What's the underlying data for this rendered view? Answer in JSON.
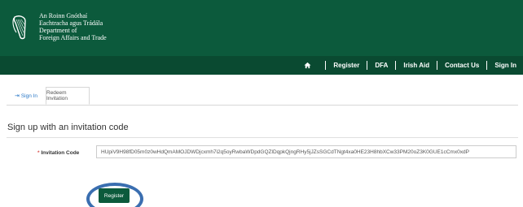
{
  "header": {
    "department_lines": [
      "An Roinn Gnóthaí",
      "Eachtracha agus Trádála",
      "Department of",
      "Foreign Affairs and Trade"
    ],
    "brand_color": "#0c5a3c",
    "logo_icon": "harp-icon"
  },
  "nav": {
    "home_icon": "home-icon",
    "items": [
      "Register",
      "DFA",
      "Irish Aid",
      "Contact Us",
      "Sign In"
    ]
  },
  "tabs": {
    "items": [
      {
        "label": "Sign In",
        "icon": "sign-in-icon",
        "active": false
      },
      {
        "label": "Redeem Invitation",
        "active": true
      }
    ]
  },
  "form": {
    "heading": "Sign up with an invitation code",
    "code_label_required": "*",
    "code_label": "Invitation Code",
    "code_value": "HUpiV9H98fD05m0z0wHdQmAMOJDWDjcxmh7i2q5oyRwbaWDpdGQZlDqpkQjngRHy5jJZsSGCdTNgt4xa0HE23H8hbXCw33PM20oZ3K0GUE1cCmx0xdP",
    "register_label": "Register",
    "highlight_color": "#3a6eb0"
  }
}
